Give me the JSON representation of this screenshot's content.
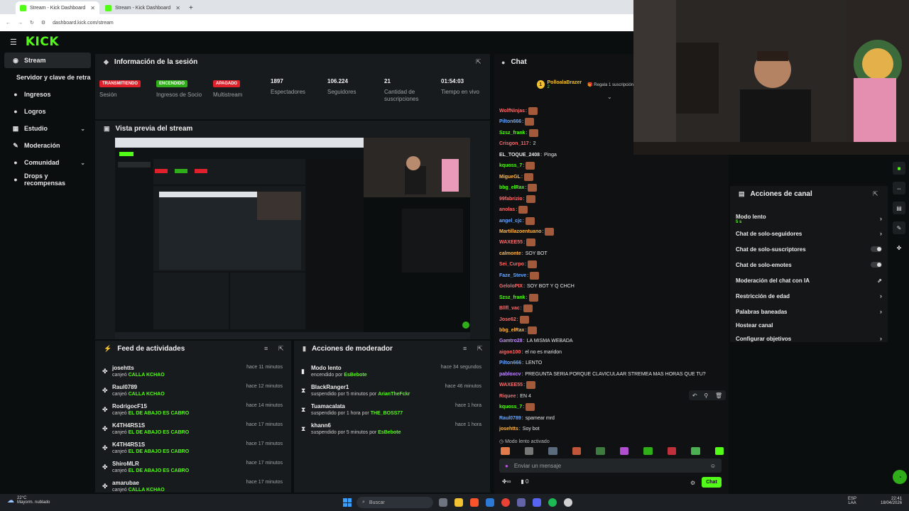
{
  "browser": {
    "tabs": [
      {
        "label": "Stream - Kick Dashboard",
        "active": true
      },
      {
        "label": "Stream - Kick Dashboard",
        "active": false
      }
    ],
    "new_tab": "+",
    "url": "dashboard.kick.com/stream"
  },
  "app": {
    "logo": "KICK",
    "accent": "#53fc18"
  },
  "sidebar": {
    "items": [
      {
        "label": "Stream",
        "icon": "broadcast-icon",
        "glyph": "◉"
      },
      {
        "label": "Servidor y clave de retransmisión",
        "icon": "",
        "glyph": ""
      },
      {
        "label": "Ingresos",
        "icon": "money-icon",
        "glyph": "●"
      },
      {
        "label": "Logros",
        "icon": "trophy-icon",
        "glyph": "●"
      },
      {
        "label": "Estudio",
        "icon": "studio-icon",
        "glyph": "▦"
      },
      {
        "label": "Moderación",
        "icon": "sword-icon",
        "glyph": "✎"
      },
      {
        "label": "Comunidad",
        "icon": "community-icon",
        "glyph": "●"
      },
      {
        "label": "Drops y recompensas",
        "icon": "gift-icon",
        "glyph": "●"
      }
    ]
  },
  "session": {
    "title": "Información de la sesión",
    "stats": [
      {
        "badge": "TRANSMITIENDO",
        "label": "Sesión",
        "badge_color": "#e0202a"
      },
      {
        "badge": "ENCENDIDO",
        "label": "Ingresos de Socio",
        "badge_color": "#2fae1a"
      },
      {
        "badge": "APAGADO",
        "label": "Multistream",
        "badge_color": "#e0202a"
      },
      {
        "value": "1897",
        "label": "Espectadores"
      },
      {
        "value": "106.224",
        "label": "Seguidores"
      },
      {
        "value": "21",
        "label": "Cantidad de suscripciones"
      },
      {
        "value": "01:54:03",
        "label": "Tiempo en vivo"
      }
    ]
  },
  "preview": {
    "title": "Vista previa del stream"
  },
  "feed": {
    "title": "Feed de actividades",
    "rows": [
      {
        "name": "josehtts",
        "action": "canjeó",
        "item": "CALLA KCHAO",
        "time": "hace 11 minutos"
      },
      {
        "name": "Raul0789",
        "action": "canjeó",
        "item": "CALLA KCHAO",
        "time": "hace 12 minutos"
      },
      {
        "name": "RodrigocF15",
        "action": "canjeó",
        "item": "EL DE ABAJO ES CABRO",
        "time": "hace 14 minutos"
      },
      {
        "name": "K4TH4RS1S",
        "action": "canjeó",
        "item": "EL DE ABAJO ES CABRO",
        "time": "hace 17 minutos"
      },
      {
        "name": "K4TH4RS1S",
        "action": "canjeó",
        "item": "EL DE ABAJO ES CABRO",
        "time": "hace 17 minutos"
      },
      {
        "name": "ShiroMLR",
        "action": "canjeó",
        "item": "EL DE ABAJO ES CABRO",
        "time": "hace 17 minutos"
      },
      {
        "name": "amarubae",
        "action": "canjeó",
        "item": "CALLA KCHAO",
        "time": "hace 17 minutos"
      }
    ]
  },
  "modactions": {
    "title": "Acciones de moderador",
    "rows": [
      {
        "name": "Modo lento",
        "action": "encendido por",
        "by": "EsBebote",
        "time": "hace 34 segundos"
      },
      {
        "name": "BlackRanger1",
        "action": "suspendido por 5 minutos por",
        "by": "ArianTheFckr",
        "time": "hace 46 minutos"
      },
      {
        "name": "Tuamacalata",
        "action": "suspendido por 1 hora por",
        "by": "THE_BOSS77",
        "time": "hace 1 hora"
      },
      {
        "name": "khann6",
        "action": "suspendido por 5 minutos por",
        "by": "EsBebote",
        "time": "hace 1 hora"
      }
    ]
  },
  "chat": {
    "title": "Chat",
    "pinned_user": "PolloalaBrazer",
    "pinned_count": "2",
    "pinned_text": "Regala 1 suscripción",
    "messages": [
      {
        "user": "WolfNinjas",
        "color": "#ff6b6b",
        "text": "",
        "emote": true
      },
      {
        "user": "Pilton666",
        "color": "#6aa8ff",
        "text": "",
        "emote": true
      },
      {
        "user": "Szsz_frank",
        "color": "#53fc18",
        "text": "",
        "emote": true
      },
      {
        "user": "Crisgon_117",
        "color": "#ff6b6b",
        "text": "2",
        "emote": false
      },
      {
        "user": "EL_TOQUE_2408",
        "color": "#e8e8e8",
        "text": "Pinga",
        "emote": false
      },
      {
        "user": "kquoss_7",
        "color": "#53fc18",
        "text": "",
        "emote": true
      },
      {
        "user": "MigueGL",
        "color": "#ffb84d",
        "text": "",
        "emote": true
      },
      {
        "user": "bbg_elRax",
        "color": "#53fc18",
        "text": "",
        "emote": true
      },
      {
        "user": "99fabrizio",
        "color": "#ff6b6b",
        "text": "",
        "emote": true
      },
      {
        "user": "anolas",
        "color": "#ff6b6b",
        "text": "",
        "emote": true
      },
      {
        "user": "angel_cjc",
        "color": "#6aa8ff",
        "text": "",
        "emote": true
      },
      {
        "user": "Martillazoentuano",
        "color": "#ffb84d",
        "text": "",
        "emote": true
      },
      {
        "user": "WAXEE55",
        "color": "#ff6b6b",
        "text": "",
        "emote": true
      },
      {
        "user": "calmonte",
        "color": "#ffb84d",
        "text": "SOY BOT",
        "emote": false
      },
      {
        "user": "Sei_Curpo",
        "color": "#ff6b6b",
        "text": "",
        "emote": true
      },
      {
        "user": "Faze_Steve",
        "color": "#6aa8ff",
        "text": "",
        "emote": true
      },
      {
        "user": "GeloloPIX",
        "color": "#ff6b6b",
        "text": "SOY BOT Y Q CHCH",
        "emote": false
      },
      {
        "user": "Szsz_frank",
        "color": "#53fc18",
        "text": "",
        "emote": true
      },
      {
        "user": "Bllfl_vac",
        "color": "#ff6b6b",
        "text": "",
        "emote": true
      },
      {
        "user": "Jose62",
        "color": "#ff6b6b",
        "text": "",
        "emote": true
      },
      {
        "user": "bbg_elRax",
        "color": "#ffb84d",
        "text": "",
        "emote": true
      },
      {
        "user": "Gamtro28",
        "color": "#c08bff",
        "text": "LA MISMA WEBADA",
        "emote": false
      },
      {
        "user": "aigon100",
        "color": "#ff6b6b",
        "text": "el no es maridon",
        "emote": false
      },
      {
        "user": "Pilton666",
        "color": "#6aa8ff",
        "text": "LENTO",
        "emote": false
      },
      {
        "user": "pabloxcv",
        "color": "#c08bff",
        "text": "PREGUNTA SERIA PORQUE CLAVICULAAR STREMEA MAS HORAS QUE TU?",
        "emote": false
      },
      {
        "user": "WAXEE55",
        "color": "#ff6b6b",
        "text": "",
        "emote": true
      },
      {
        "user": "Riquee",
        "color": "#ff6b6b",
        "text": "EN 4",
        "emote": false
      },
      {
        "user": "kquoss_7",
        "color": "#53fc18",
        "text": "",
        "emote": true
      },
      {
        "user": "Raul0789",
        "color": "#6aa8ff",
        "text": "spamear mrd",
        "emote": false
      },
      {
        "user": "josehtts",
        "color": "#ffb84d",
        "text": "Soy bot",
        "emote": false
      }
    ],
    "slow_mode_notice": "Modo lento activado",
    "input_placeholder": "Enviar un mensaje",
    "send_label": "Chat",
    "counter": "0"
  },
  "channel_actions": {
    "title": "Acciones de canal",
    "rows": [
      {
        "label": "Modo lento",
        "sub": "5 s",
        "control": "arrow"
      },
      {
        "label": "Chat de solo-seguidores",
        "control": "arrow"
      },
      {
        "label": "Chat de solo-suscriptores",
        "control": "toggle"
      },
      {
        "label": "Chat de solo-emotes",
        "control": "toggle"
      },
      {
        "label": "Moderación del chat con IA",
        "control": "ext"
      },
      {
        "label": "Restricción de edad",
        "control": "arrow"
      },
      {
        "label": "Palabras baneadas",
        "control": "arrow"
      },
      {
        "label": "Hostear canal",
        "control": "none"
      },
      {
        "label": "Configurar objetivos",
        "control": "arrow"
      }
    ]
  },
  "taskbar": {
    "weather_temp": "22°C",
    "weather_desc": "Mayorm. nublado",
    "search_placeholder": "Buscar",
    "lang": "ESP",
    "lang2": "LAA",
    "time": "22:41",
    "date": "18/04/2026"
  }
}
